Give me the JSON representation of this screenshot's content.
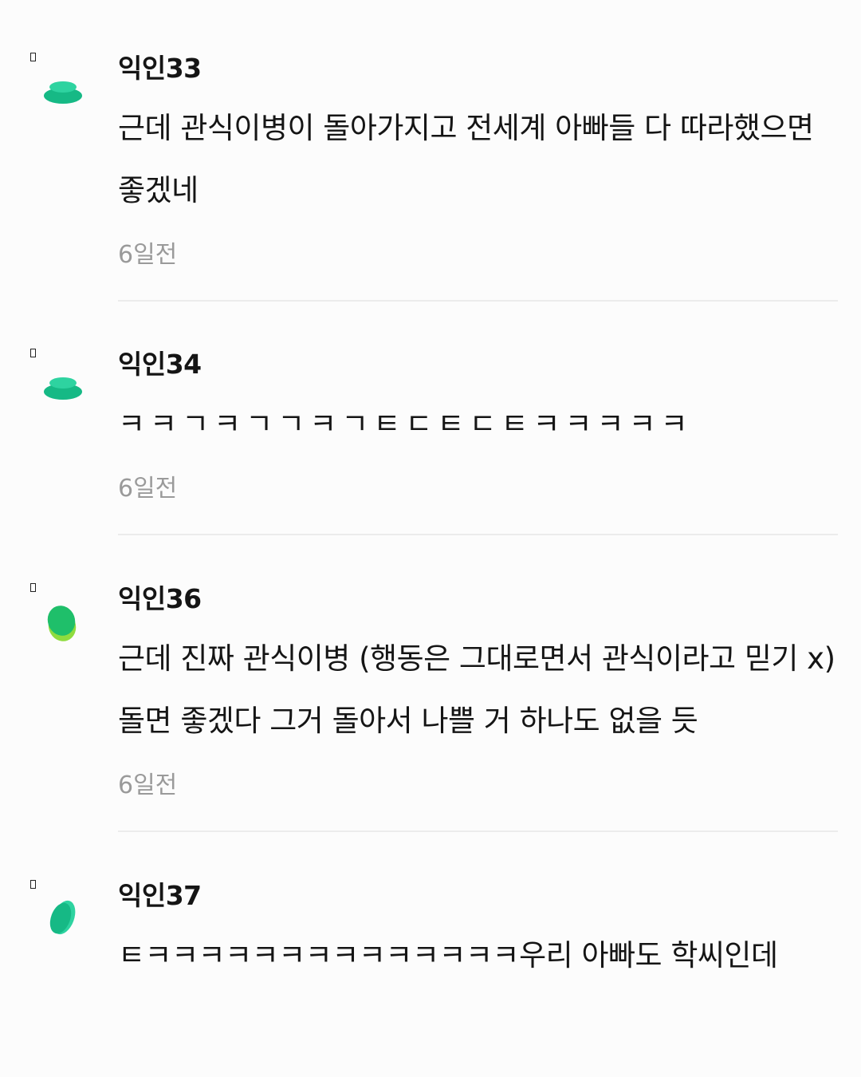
{
  "comments": [
    {
      "nickname": "익인33",
      "text": "근데 관식이병이 돌아가지고 전세계 아빠들 다 따라했으면 좋겠네",
      "time": "6일전"
    },
    {
      "nickname": "익인34",
      "text": "ㅋㅋㄱㅋㄱㄱㅋㄱㅌㄷㅌㄷㅌㅋㅋㅋㅋㅋ",
      "time": "6일전"
    },
    {
      "nickname": "익인36",
      "text": "근데 진짜 관식이병 (행동은 그대로면서 관식이라고 믿기 x) 돌면 좋겠다 그거 돌아서 나쁠 거 하나도 없을 듯",
      "time": "6일전"
    },
    {
      "nickname": "익인37",
      "text": "ㅌㅋㅋㅋㅋㅋㅋㅋㅋㅋㅋㅋㅋㅋㅋ우리 아빠도 학씨인데"
    }
  ],
  "colors": {
    "avatar_teal": "#2ed3a0",
    "avatar_teal_dark": "#16b985",
    "avatar_green": "#1fbf6a",
    "avatar_lime": "#8fdc3f",
    "meta_text": "#9a9a9a",
    "divider": "#ececec"
  }
}
